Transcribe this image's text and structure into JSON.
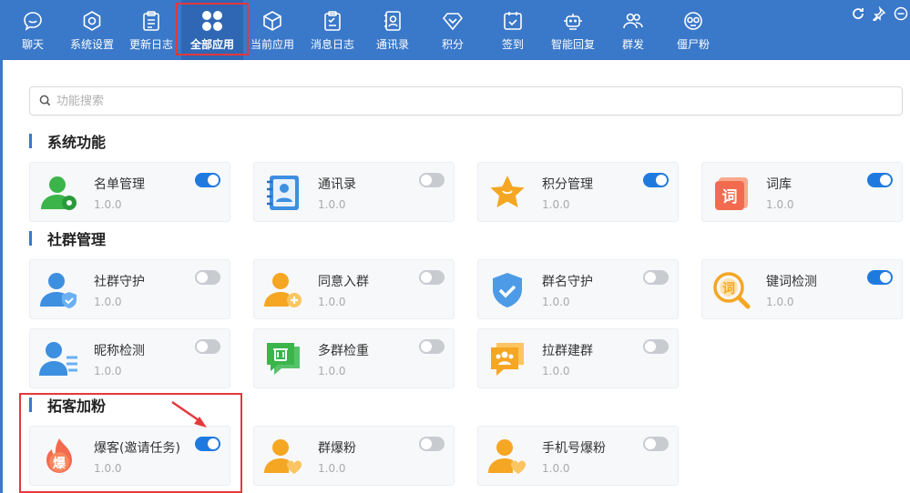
{
  "toolbar": {
    "items": [
      {
        "label": "聊天",
        "icon": "chat-icon"
      },
      {
        "label": "系统设置",
        "icon": "hexagon-settings-icon"
      },
      {
        "label": "更新日志",
        "icon": "clipboard-icon"
      },
      {
        "label": "全部应用",
        "icon": "apps-grid-icon"
      },
      {
        "label": "当前应用",
        "icon": "cube-icon"
      },
      {
        "label": "消息日志",
        "icon": "clipboard-list-icon"
      },
      {
        "label": "通讯录",
        "icon": "contacts-book-icon"
      },
      {
        "label": "积分",
        "icon": "diamond-icon"
      },
      {
        "label": "签到",
        "icon": "calendar-check-icon"
      },
      {
        "label": "智能回复",
        "icon": "robot-icon"
      },
      {
        "label": "群发",
        "icon": "group-users-icon"
      },
      {
        "label": "僵尸粉",
        "icon": "zombie-face-icon"
      }
    ],
    "active_index": 3
  },
  "search": {
    "placeholder": "功能搜索"
  },
  "sections": {
    "system": {
      "title": "系统功能",
      "cards": [
        {
          "name": "名单管理",
          "version": "1.0.0",
          "on": true,
          "icon": "user-gear-icon"
        },
        {
          "name": "通讯录",
          "version": "1.0.0",
          "on": false,
          "icon": "address-book-icon"
        },
        {
          "name": "积分管理",
          "version": "1.0.0",
          "on": true,
          "icon": "star-icon"
        },
        {
          "name": "词库",
          "version": "1.0.0",
          "on": true,
          "icon": "word-library-icon"
        }
      ]
    },
    "community": {
      "title": "社群管理",
      "cards": [
        {
          "name": "社群守护",
          "version": "1.0.0",
          "on": false,
          "icon": "user-shield-icon"
        },
        {
          "name": "同意入群",
          "version": "1.0.0",
          "on": false,
          "icon": "user-add-icon"
        },
        {
          "name": "群名守护",
          "version": "1.0.0",
          "on": false,
          "icon": "shield-check-icon"
        },
        {
          "name": "键词检测",
          "version": "1.0.0",
          "on": true,
          "icon": "keyword-search-icon"
        },
        {
          "name": "昵称检测",
          "version": "1.0.0",
          "on": false,
          "icon": "user-list-icon"
        },
        {
          "name": "多群检重",
          "version": "1.0.0",
          "on": false,
          "icon": "chat-trash-icon"
        },
        {
          "name": "拉群建群",
          "version": "1.0.0",
          "on": false,
          "icon": "group-chat-icon"
        }
      ]
    },
    "growth": {
      "title": "拓客加粉",
      "cards": [
        {
          "name": "爆客(邀请任务)",
          "version": "1.0.0",
          "on": true,
          "icon": "fire-icon",
          "icon_text": "爆"
        },
        {
          "name": "群爆粉",
          "version": "1.0.0",
          "on": false,
          "icon": "user-heart-icon"
        },
        {
          "name": "手机号爆粉",
          "version": "1.0.0",
          "on": false,
          "icon": "user-heart-icon"
        }
      ]
    }
  },
  "colors": {
    "toolbar": "#3a78c9",
    "toggle_on": "#1f7ae0",
    "highlight": "#e5383b",
    "accent_green": "#3bb54a",
    "accent_orange": "#f5a623",
    "accent_blue": "#3d8fe0",
    "accent_red": "#f26b4f"
  }
}
